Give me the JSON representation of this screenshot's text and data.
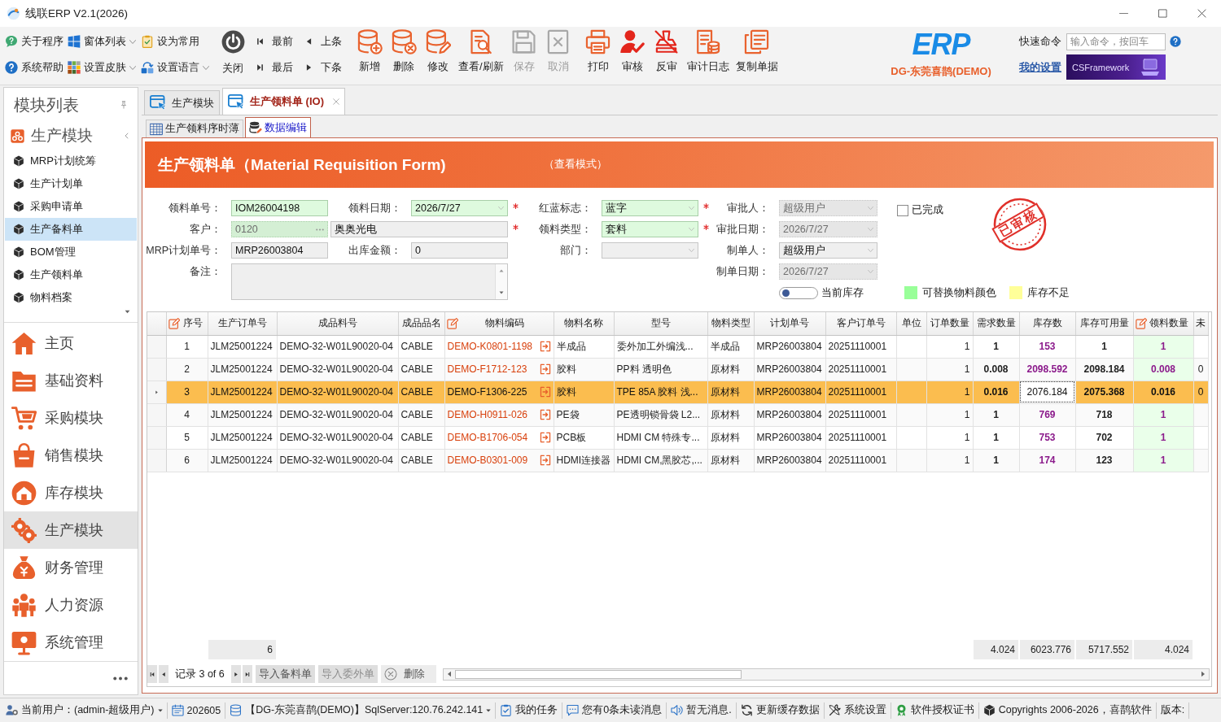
{
  "window": {
    "title": "线联ERP V2.1(2026)"
  },
  "ribbon": {
    "small_buttons": [
      {
        "label": "关于程序",
        "dropdown": false
      },
      {
        "label": "窗体列表",
        "dropdown": true
      },
      {
        "label": "设为常用",
        "dropdown": false
      },
      {
        "label": "系统帮助",
        "dropdown": false
      },
      {
        "label": "设置皮肤",
        "dropdown": true
      },
      {
        "label": "设置语言",
        "dropdown": true
      }
    ],
    "close_button": "关闭",
    "navigation": [
      "最前",
      "上条",
      "最后",
      "下条"
    ],
    "actions": [
      {
        "label": "新增",
        "disabled": false
      },
      {
        "label": "删除",
        "disabled": false
      },
      {
        "label": "修改",
        "disabled": false
      },
      {
        "label": "查看/刷新",
        "disabled": false
      },
      {
        "label": "保存",
        "disabled": true
      },
      {
        "label": "取消",
        "disabled": true
      },
      {
        "label": "打印",
        "disabled": false
      },
      {
        "label": "审核",
        "disabled": false
      },
      {
        "label": "反审",
        "disabled": false
      },
      {
        "label": "审计日志",
        "disabled": false
      },
      {
        "label": "复制单据",
        "disabled": false
      }
    ],
    "brand": {
      "logo": "ERP",
      "company": "DG-东莞喜鹊(DEMO)"
    },
    "quick_command": {
      "label": "快速命令",
      "placeholder": "输入命令，按回车"
    },
    "settings_link": "我的设置",
    "banner": "CSFramework"
  },
  "sidebar": {
    "title": "模块列表",
    "group": "生产模块",
    "items": [
      {
        "label": "MRP计划统筹",
        "selected": false
      },
      {
        "label": "生产计划单",
        "selected": false
      },
      {
        "label": "采购申请单",
        "selected": false
      },
      {
        "label": "生产备料单",
        "selected": true
      },
      {
        "label": "BOM管理",
        "selected": false
      },
      {
        "label": "生产领料单",
        "selected": false
      },
      {
        "label": "物料档案",
        "selected": false
      }
    ],
    "modules": [
      {
        "label": "主页",
        "selected": false
      },
      {
        "label": "基础资料",
        "selected": false
      },
      {
        "label": "采购模块",
        "selected": false
      },
      {
        "label": "销售模块",
        "selected": false
      },
      {
        "label": "库存模块",
        "selected": false
      },
      {
        "label": "生产模块",
        "selected": true
      },
      {
        "label": "财务管理",
        "selected": false
      },
      {
        "label": "人力资源",
        "selected": false
      },
      {
        "label": "系统管理",
        "selected": false
      }
    ]
  },
  "doc_tabs": [
    {
      "label": "生产模块",
      "selected": false,
      "closable": false
    },
    {
      "label": "生产领料单 (IO)",
      "selected": true,
      "closable": true
    }
  ],
  "sub_tabs": [
    {
      "label": "生产领料序时薄",
      "selected": false
    },
    {
      "label": "数据编辑",
      "selected": true
    }
  ],
  "form": {
    "title": "生产领料单（Material Requisition Form)",
    "mode": "（查看模式）",
    "fields": [
      {
        "label": "领料单号：",
        "value": "IOM26004198",
        "kind": "text",
        "required": true,
        "starred": false,
        "disabled": false
      },
      {
        "label": "领料日期：",
        "value": "2026/7/27",
        "kind": "dropdown",
        "required": true,
        "starred": true,
        "disabled": false
      },
      {
        "label": "红蓝标志：",
        "value": "蓝字",
        "kind": "dropdown",
        "required": true,
        "starred": true,
        "disabled": false
      },
      {
        "label": "审批人：",
        "value": "超级用户",
        "kind": "dropdown",
        "required": false,
        "starred": false,
        "disabled": true
      },
      {
        "label": "客户：",
        "value": "0120",
        "name": "奥奥光电",
        "kind": "lookup",
        "required": true,
        "starred": true,
        "disabled": true
      },
      {
        "label": "领料类型：",
        "value": "套料",
        "kind": "dropdown",
        "required": true,
        "starred": true,
        "disabled": false
      },
      {
        "label": "审批日期：",
        "value": "2026/7/27",
        "kind": "dropdown",
        "required": false,
        "starred": false,
        "disabled": true
      },
      {
        "label": "MRP计划单号：",
        "value": "MRP26003804",
        "kind": "text",
        "required": false,
        "starred": false,
        "disabled": false
      },
      {
        "label": "出库金额：",
        "value": "0",
        "kind": "text",
        "required": false,
        "starred": false,
        "disabled": false
      },
      {
        "label": "部门：",
        "kind": "dropdown",
        "required": false,
        "starred": false,
        "disabled": false
      },
      {
        "label": "制单人：",
        "value": "超级用户",
        "kind": "dropdown",
        "required": false,
        "starred": false,
        "disabled": false
      },
      {
        "label": "备注：",
        "kind": "memo",
        "required": false,
        "starred": false,
        "disabled": false
      },
      {
        "label": "制单日期：",
        "value": "2026/7/27",
        "kind": "dropdown",
        "required": false,
        "starred": false,
        "disabled": true
      }
    ],
    "completed": {
      "label": "已完成",
      "checked": false
    },
    "stamp": "已审核",
    "stock_toggle": {
      "label": "当前库存",
      "on": false
    },
    "legend": [
      {
        "label": "可替换物料颜色",
        "color": "#99ff99"
      },
      {
        "label": "库存不足",
        "color": "#ffff99"
      }
    ]
  },
  "grid": {
    "columns": [
      {
        "label": "序号",
        "editable": true
      },
      {
        "label": "生产订单号",
        "editable": false
      },
      {
        "label": "成品料号",
        "editable": false
      },
      {
        "label": "成品品名",
        "editable": false
      },
      {
        "label": "物料编码",
        "editable": true
      },
      {
        "label": "物料名称",
        "editable": false
      },
      {
        "label": "型号",
        "editable": false
      },
      {
        "label": "物料类型",
        "editable": false
      },
      {
        "label": "计划单号",
        "editable": false
      },
      {
        "label": "客户订单号",
        "editable": false
      },
      {
        "label": "单位",
        "editable": false
      },
      {
        "label": "订单数量",
        "editable": false
      },
      {
        "label": "需求数量",
        "editable": false
      },
      {
        "label": "库存数",
        "editable": false
      },
      {
        "label": "库存可用量",
        "editable": false
      },
      {
        "label": "领料数量",
        "editable": true
      },
      {
        "label": "未",
        "editable": false
      }
    ],
    "rows": [
      {
        "seq": "1",
        "production_order": "JLM25001224",
        "product_code": "DEMO-32-W01L90020-04",
        "product_name": "CABLE",
        "material_code": "DEMO-K0801-1198",
        "material_name": "半成品",
        "model": "委外加工外编浅...",
        "material_type": "半成品",
        "plan_no": "MRP26003804",
        "customer_order": "20251110001",
        "order_qty": "1",
        "required_qty": "1",
        "stock_qty": "153",
        "available_qty": "1",
        "issue_qty": "1",
        "selected": false,
        "stock_focused": false
      },
      {
        "seq": "2",
        "production_order": "JLM25001224",
        "product_code": "DEMO-32-W01L90020-04",
        "product_name": "CABLE",
        "material_code": "DEMO-F1712-123",
        "material_name": "胶料",
        "model": "PP料 透明色",
        "material_type": "原材料",
        "plan_no": "MRP26003804",
        "customer_order": "20251110001",
        "order_qty": "1",
        "required_qty": "0.008",
        "stock_qty": "2098.592",
        "available_qty": "2098.184",
        "issue_qty": "0.008",
        "column_18": "0",
        "selected": false,
        "stock_focused": false
      },
      {
        "seq": "3",
        "production_order": "JLM25001224",
        "product_code": "DEMO-32-W01L90020-04",
        "product_name": "CABLE",
        "material_code": "DEMO-F1306-225",
        "material_name": "胶料",
        "model": "TPE 85A 胶料 浅...",
        "material_type": "原材料",
        "plan_no": "MRP26003804",
        "customer_order": "20251110001",
        "order_qty": "1",
        "required_qty": "0.016",
        "stock_qty": "2076.184",
        "available_qty": "2075.368",
        "issue_qty": "0.016",
        "column_18": "0",
        "selected": true,
        "stock_focused": true
      },
      {
        "seq": "4",
        "production_order": "JLM25001224",
        "product_code": "DEMO-32-W01L90020-04",
        "product_name": "CABLE",
        "material_code": "DEMO-H0911-026",
        "material_name": "PE袋",
        "model": "PE透明锁骨袋 L2...",
        "material_type": "原材料",
        "plan_no": "MRP26003804",
        "customer_order": "20251110001",
        "order_qty": "1",
        "required_qty": "1",
        "stock_qty": "769",
        "available_qty": "718",
        "issue_qty": "1",
        "selected": false,
        "stock_focused": false
      },
      {
        "seq": "5",
        "production_order": "JLM25001224",
        "product_code": "DEMO-32-W01L90020-04",
        "product_name": "CABLE",
        "material_code": "DEMO-B1706-054",
        "material_name": "PCB板",
        "model": "HDMI CM 特殊专...",
        "material_type": "原材料",
        "plan_no": "MRP26003804",
        "customer_order": "20251110001",
        "order_qty": "1",
        "required_qty": "1",
        "stock_qty": "753",
        "available_qty": "702",
        "issue_qty": "1",
        "selected": false,
        "stock_focused": false
      },
      {
        "seq": "6",
        "production_order": "JLM25001224",
        "product_code": "DEMO-32-W01L90020-04",
        "product_name": "CABLE",
        "material_code": "DEMO-B0301-009",
        "material_name": "HDMI连接器",
        "model": "HDMI CM,黑胶芯,...",
        "material_type": "原材料",
        "plan_no": "MRP26003804",
        "customer_order": "20251110001",
        "order_qty": "1",
        "required_qty": "1",
        "stock_qty": "174",
        "available_qty": "123",
        "issue_qty": "1",
        "selected": false,
        "stock_focused": false
      }
    ],
    "summary": {
      "production_order": "6",
      "required_qty": "4.024",
      "stock_qty": "6023.776",
      "available_qty": "5717.552",
      "issue_qty": "4.024"
    }
  },
  "navigator": {
    "record": "记录 3 of 6",
    "buttons": [
      {
        "label": "导入备料单",
        "kind": "import",
        "disabled": false
      },
      {
        "label": "导入委外单",
        "kind": "import",
        "disabled": true
      },
      {
        "label": "删除",
        "kind": "delete",
        "disabled": false
      }
    ]
  },
  "status_bar": [
    {
      "text": "当前用户：(admin-超级用户)",
      "dropdown": true
    },
    {
      "text": "202605",
      "dropdown": false
    },
    {
      "text": "【DG-东莞喜鹊(DEMO)】SqlServer:120.76.242.141",
      "dropdown": true
    },
    {
      "text": "我的任务",
      "dropdown": false
    },
    {
      "text": "您有0条未读消息",
      "dropdown": false
    },
    {
      "text": "暂无消息.",
      "dropdown": false
    },
    {
      "text": "更新缓存数据",
      "dropdown": false
    },
    {
      "text": "系统设置",
      "dropdown": false
    },
    {
      "text": "软件授权证书",
      "dropdown": false
    },
    {
      "text": "Copyrights 2006-2026，喜鹊软件",
      "dropdown": false
    },
    {
      "text": "版本:",
      "dropdown": false
    }
  ]
}
